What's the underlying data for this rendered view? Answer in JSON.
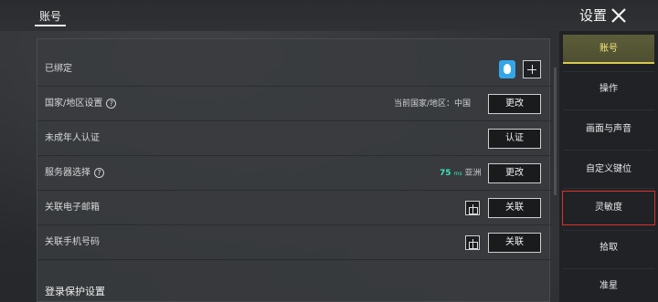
{
  "header": {
    "account_tab": "账号",
    "title": "设置"
  },
  "rows": [
    {
      "label": "已绑定"
    },
    {
      "label": "国家/地区设置",
      "status": "当前国家/地区：中国",
      "button": "更改"
    },
    {
      "label": "未成年人认证",
      "button": "认证"
    },
    {
      "label": "服务器选择",
      "ping": "75",
      "ping_unit": "ms",
      "region": "亚洲",
      "button": "更改"
    },
    {
      "label": "关联电子邮箱",
      "button": "关联"
    },
    {
      "label": "关联手机号码",
      "button": "关联"
    }
  ],
  "help_glyph": "?",
  "section_title": "登录保护设置",
  "sidebar": {
    "items": [
      {
        "label": "账号",
        "active": true
      },
      {
        "label": "操作"
      },
      {
        "label": "画面与声音"
      },
      {
        "label": "自定义键位"
      },
      {
        "label": "灵敏度",
        "highlighted": true
      },
      {
        "label": "拾取"
      },
      {
        "label": "准星"
      }
    ]
  },
  "colors": {
    "accent_yellow": "#f7e97a",
    "ping_green": "#37e6b9",
    "highlight_red": "#d9342b",
    "qq_blue": "#34a6e8"
  },
  "icons": [
    "qq-icon",
    "add-icon",
    "help-icon",
    "gift-icon",
    "close-icon"
  ]
}
